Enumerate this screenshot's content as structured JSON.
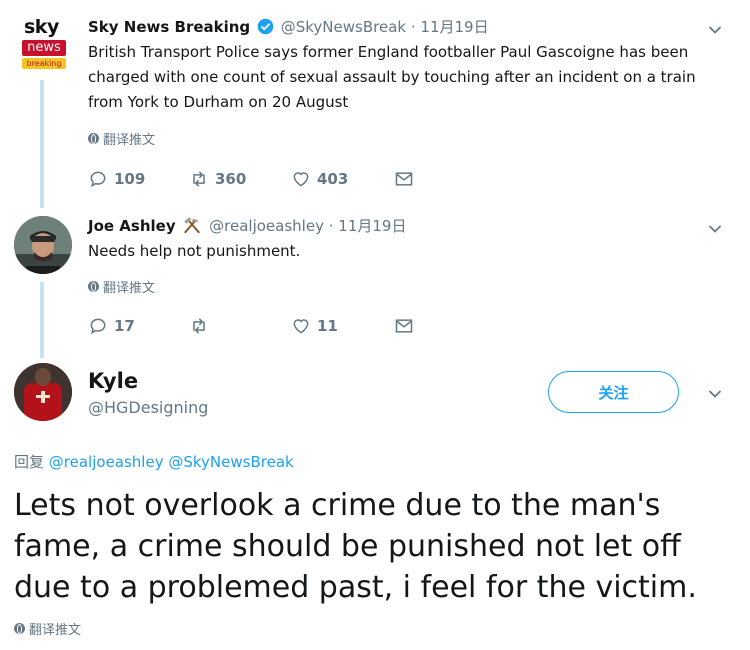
{
  "tweet1": {
    "name": "Sky News Breaking",
    "handle": "@SkyNewsBreak",
    "date": "· 11月19日",
    "logo": {
      "top": "sky",
      "middle": "news",
      "bottom": "breaking"
    },
    "text": "British Transport Police says former England footballer Paul Gascoigne has been charged with one count of sexual assault by touching after an incident on a train from York to Durham on 20 August",
    "translate": "翻译推文",
    "replies": "109",
    "retweets": "360",
    "likes": "403"
  },
  "tweet2": {
    "name": "Joe Ashley",
    "handle": "@realjoeashley",
    "date": "· 11月19日",
    "text": "Needs help not punishment.",
    "translate": "翻译推文",
    "replies": "17",
    "retweets": "",
    "likes": "11"
  },
  "main_tweet": {
    "name": "Kyle",
    "handle": "@HGDesigning",
    "follow_label": "关注",
    "reply_prefix": "回复",
    "reply_mention_1": "@realjoeashley",
    "reply_mention_2": "@SkyNewsBreak",
    "text": "Lets not overlook a crime due to the man's fame, a crime should be punished not let off due to a problemed past, i feel for the victim.",
    "translate": "翻译推文"
  },
  "colors": {
    "accent": "#1da1f2",
    "muted": "#657786",
    "thread_line": "#c4e2f4"
  }
}
